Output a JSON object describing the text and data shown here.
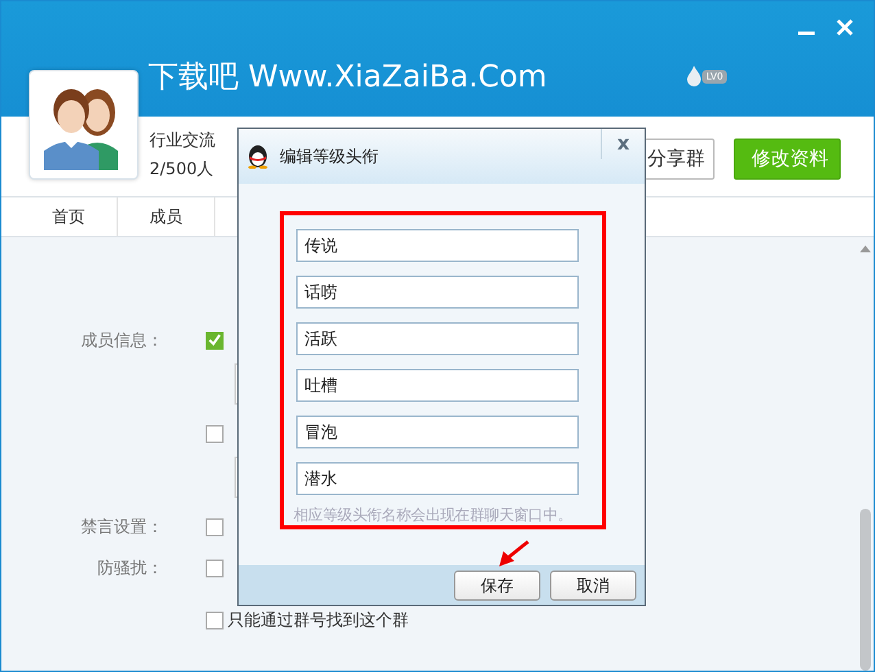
{
  "window": {
    "group_name": "下载吧 Www.XiaZaiBa.Com",
    "level_badge": "LV0",
    "category": "行业交流",
    "member_count": "2/500人"
  },
  "header_buttons": [
    {
      "label": "分享群",
      "kind": "plain"
    },
    {
      "label": "修改资料",
      "kind": "primary"
    }
  ],
  "tabs": [
    {
      "label": "首页",
      "selected": false
    },
    {
      "label": "成员",
      "selected": false
    }
  ],
  "settings": [
    {
      "label": "成员信息：",
      "checked": true,
      "kind": "option"
    },
    {
      "kind": "box"
    },
    {
      "checked": false,
      "kind": "option"
    },
    {
      "kind": "box"
    },
    {
      "label": "禁言设置：",
      "checked": false,
      "kind": "option"
    },
    {
      "label": "防骚扰：",
      "checked": false,
      "kind": "option"
    },
    {
      "option": "只能通过群号找到这个群",
      "checked": false,
      "kind": "option"
    }
  ],
  "dialog": {
    "title": "编辑等级头衔",
    "close": "x",
    "titles": [
      "传说",
      "话唠",
      "活跃",
      "吐槽",
      "冒泡",
      "潜水"
    ],
    "hint": "相应等级头衔名称会出现在群聊天窗口中。",
    "buttons": [
      "保存",
      "取消"
    ]
  }
}
